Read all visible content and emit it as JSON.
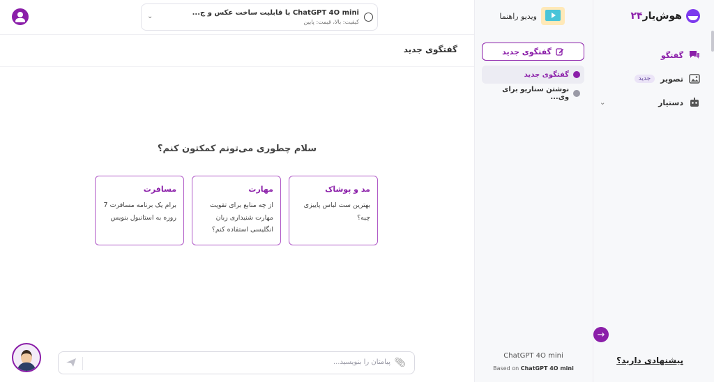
{
  "app": {
    "logo_text": "هوش‌یار",
    "logo_number": "۲۴",
    "brand_color": "#8b1fa9"
  },
  "sidebar": {
    "items": [
      {
        "label": "گفتگو",
        "icon": "chat-icon",
        "active": true
      },
      {
        "label": "تصویر",
        "icon": "image-icon",
        "badge": "جدید"
      },
      {
        "label": "دستیار",
        "icon": "robot-icon",
        "expandable": true
      }
    ],
    "suggestion_link": "پیشنهادی دارید؟"
  },
  "chatlist": {
    "video_guide": "ویدیو راهنما",
    "new_chat_button": "گفتگوی جدید",
    "chats": [
      {
        "label": "گفتگوی جدید",
        "active": true
      },
      {
        "label": "نوشتن سناریو برای وی..."
      }
    ],
    "model_name": "ChatGPT 4O mini",
    "based_on_prefix": "Based on ",
    "based_on_model": "ChatGPT 4O mini"
  },
  "header": {
    "model_title": "ChatGPT 4O mini با قابلیت ساخت عکس و ج...",
    "model_meta": "کیفیت: بالا، قیمت: پایین"
  },
  "main": {
    "page_title": "گفتگوی جدید",
    "greeting": "سلام چطوری می‌تونم کمکتون کنم؟",
    "cards": [
      {
        "title": "مد و پوشاک",
        "desc": "بهترین ست لباس پاییزی چیه؟"
      },
      {
        "title": "مهارت",
        "desc": "از چه منابع برای تقویت مهارت شنیداری زبان انگلیسی استفاده کنم؟"
      },
      {
        "title": "مسافرت",
        "desc": "برام یک برنامه مسافرت 7 روزه به استانبول بنویس"
      }
    ],
    "input_placeholder": "پیامتان را بنویسید..."
  }
}
